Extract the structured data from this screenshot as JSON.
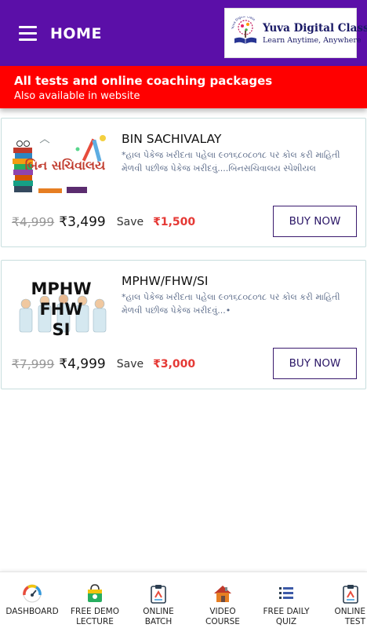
{
  "header": {
    "title": "HOME",
    "logo_name": "Yuva Digital Class",
    "logo_tagline": "Learn Anytime, Anywhere",
    "logo_arc_text": "Yuva Digital Class"
  },
  "banner": {
    "title": "All tests and online coaching packages",
    "subtitle": "Also available in website"
  },
  "packages": [
    {
      "thumb_text": "બિન સચિવાલય",
      "title": "BIN SACHIVALAY",
      "description": "*હાલ પેકેજ ખરીદતા પહેલા ૯૦૧૬૮૦૮૦૧૮ પર કોલ કરી માહિતી મેળવી પછીજ પેકેજ ખરીદવું....બિનસચિવાલય સ્પેશીયલ",
      "old_price": "₹4,999",
      "new_price": "₹3,499",
      "save_label": "Save",
      "save_amount": "₹1,500",
      "button": "BUY NOW"
    },
    {
      "thumb_lines": [
        "MPHW",
        "FHW",
        "SI"
      ],
      "title": "MPHW/FHW/SI",
      "description": "*હાલ પેકેજ ખરીદતા પહેલા ૯૦૧૬૮૦૮૦૧૮ પર કોલ કરી માહિતી મેળવી પછીજ પેકેજ ખરીદવું...•",
      "old_price": "₹7,999",
      "new_price": "₹4,999",
      "save_label": "Save",
      "save_amount": "₹3,000",
      "button": "BUY NOW"
    }
  ],
  "bottom_nav": [
    {
      "label_lines": [
        "DASHBOARD"
      ],
      "icon": "dashboard-gauge-icon"
    },
    {
      "label_lines": [
        "FREE DEMO",
        "LECTURE"
      ],
      "icon": "shopping-bag-icon"
    },
    {
      "label_lines": [
        "ONLINE",
        "BATCH"
      ],
      "icon": "clipboard-icon"
    },
    {
      "label_lines": [
        "VIDEO",
        "COURSE"
      ],
      "icon": "house-icon"
    },
    {
      "label_lines": [
        "FREE DAILY",
        "QUIZ"
      ],
      "icon": "list-icon"
    },
    {
      "label_lines": [
        "ONLINE",
        "TEST"
      ],
      "icon": "clipboard-icon"
    }
  ],
  "colors": {
    "header_bg": "#5b0fa8",
    "banner_bg": "#ff0000",
    "save_amount": "#e53935",
    "button_border": "#3a1a6e"
  }
}
